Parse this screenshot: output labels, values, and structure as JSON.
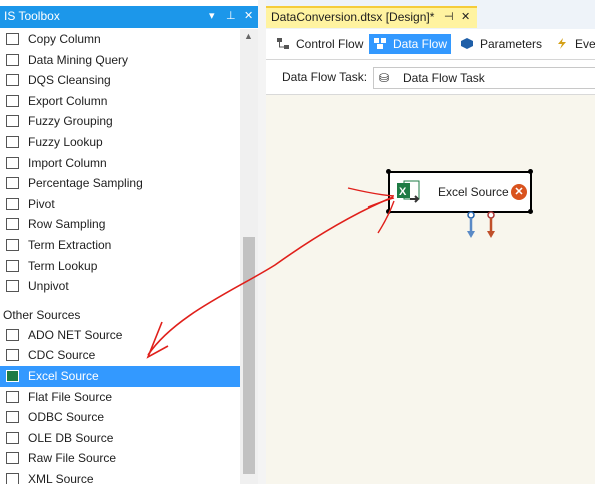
{
  "toolbox": {
    "title": "IS Toolbox",
    "header_controls": [
      "▾",
      "⊥",
      "✕"
    ],
    "items_top": [
      {
        "label": "Copy Column",
        "icon": "copy-column-icon"
      },
      {
        "label": "Data Mining Query",
        "icon": "data-mining-icon"
      },
      {
        "label": "DQS Cleansing",
        "icon": "dqs-icon"
      },
      {
        "label": "Export Column",
        "icon": "export-column-icon"
      },
      {
        "label": "Fuzzy Grouping",
        "icon": "fuzzy-grouping-icon"
      },
      {
        "label": "Fuzzy Lookup",
        "icon": "fuzzy-lookup-icon"
      },
      {
        "label": "Import Column",
        "icon": "import-column-icon"
      },
      {
        "label": "Percentage Sampling",
        "icon": "percentage-sampling-icon"
      },
      {
        "label": "Pivot",
        "icon": "pivot-icon"
      },
      {
        "label": "Row Sampling",
        "icon": "row-sampling-icon"
      },
      {
        "label": "Term Extraction",
        "icon": "term-extraction-icon"
      },
      {
        "label": "Term Lookup",
        "icon": "term-lookup-icon"
      },
      {
        "label": "Unpivot",
        "icon": "unpivot-icon"
      }
    ],
    "category": "Other Sources",
    "items_sources": [
      {
        "label": "ADO NET Source",
        "icon": "ado-net-icon"
      },
      {
        "label": "CDC Source",
        "icon": "cdc-icon"
      },
      {
        "label": "Excel Source",
        "icon": "excel-icon",
        "selected": true
      },
      {
        "label": "Flat File Source",
        "icon": "flat-file-icon"
      },
      {
        "label": "ODBC Source",
        "icon": "odbc-icon"
      },
      {
        "label": "OLE DB Source",
        "icon": "ole-db-icon"
      },
      {
        "label": "Raw File Source",
        "icon": "raw-file-icon"
      },
      {
        "label": "XML Source",
        "icon": "xml-icon"
      }
    ]
  },
  "document_tab": {
    "title": "DataConversion.dtsx [Design]*",
    "pin": "⊣",
    "close": "✕"
  },
  "designer": {
    "tabs": [
      {
        "label": "Control Flow",
        "icon": "control-flow-icon",
        "active": false
      },
      {
        "label": "Data Flow",
        "icon": "data-flow-icon",
        "active": true
      },
      {
        "label": "Parameters",
        "icon": "parameters-icon",
        "active": false
      },
      {
        "label": "Eve",
        "icon": "event-handlers-icon",
        "active": false
      }
    ],
    "task_label": "Data Flow Task:",
    "task_value": "Data Flow Task"
  },
  "component": {
    "label": "Excel Source",
    "error_glyph": "✕"
  },
  "colors": {
    "header_blue": "#1c97ea",
    "selection_blue": "#3399ff",
    "doc_tab_yellow": "#fff3a0",
    "annotation_red": "#e0201b",
    "error_orange": "#d9531e",
    "excel_green": "#1e7b44"
  }
}
